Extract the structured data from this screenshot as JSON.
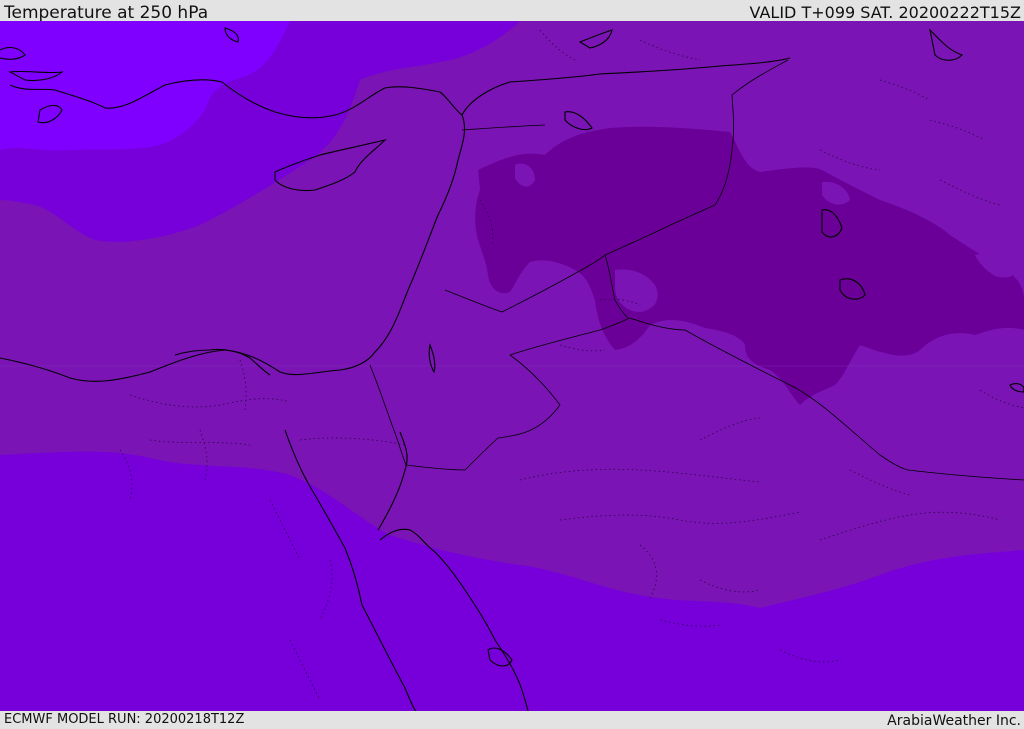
{
  "header": {
    "title": "Temperature at 250 hPa",
    "valid_time": "VALID T+099 SAT. 20200222T15Z"
  },
  "footer": {
    "model_run": "ECMWF MODEL RUN: 20200218T12Z",
    "credit": "ArabiaWeather Inc."
  },
  "colors": {
    "coldest_band": "#6a0098",
    "cold_band": "#7a14b4",
    "mid_band": "#7700da",
    "warm_band": "#8000ff",
    "page_background": "#e3e3e3"
  }
}
